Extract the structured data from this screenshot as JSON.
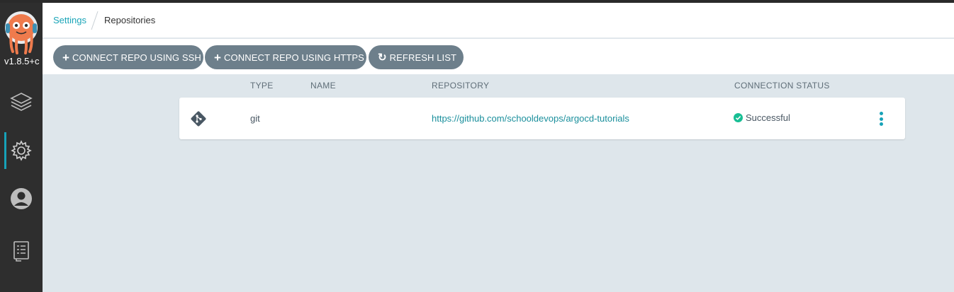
{
  "app": {
    "version": "v1.8.5+c",
    "accent_color": "#17a2b8"
  },
  "sidebar": {
    "items": [
      {
        "icon": "layers-icon",
        "name": "applications"
      },
      {
        "icon": "gear-icon",
        "name": "settings",
        "active": true
      },
      {
        "icon": "user-icon",
        "name": "user-info"
      },
      {
        "icon": "docs-icon",
        "name": "documentation"
      }
    ]
  },
  "breadcrumb": {
    "parent": "Settings",
    "current": "Repositories"
  },
  "toolbar": {
    "connect_ssh_label": "CONNECT REPO USING SSH",
    "connect_https_label": "CONNECT REPO USING HTTPS",
    "refresh_label": "REFRESH LIST",
    "button_color": "#6d7f8b"
  },
  "table": {
    "columns": {
      "type": "TYPE",
      "name": "NAME",
      "repository": "REPOSITORY",
      "status": "CONNECTION STATUS"
    },
    "rows": [
      {
        "icon": "git-icon",
        "type": "git",
        "name": "",
        "repository": "https://github.com/schooldevops/argocd-tutorials",
        "status": "Successful",
        "status_color": "#18be94"
      }
    ]
  }
}
